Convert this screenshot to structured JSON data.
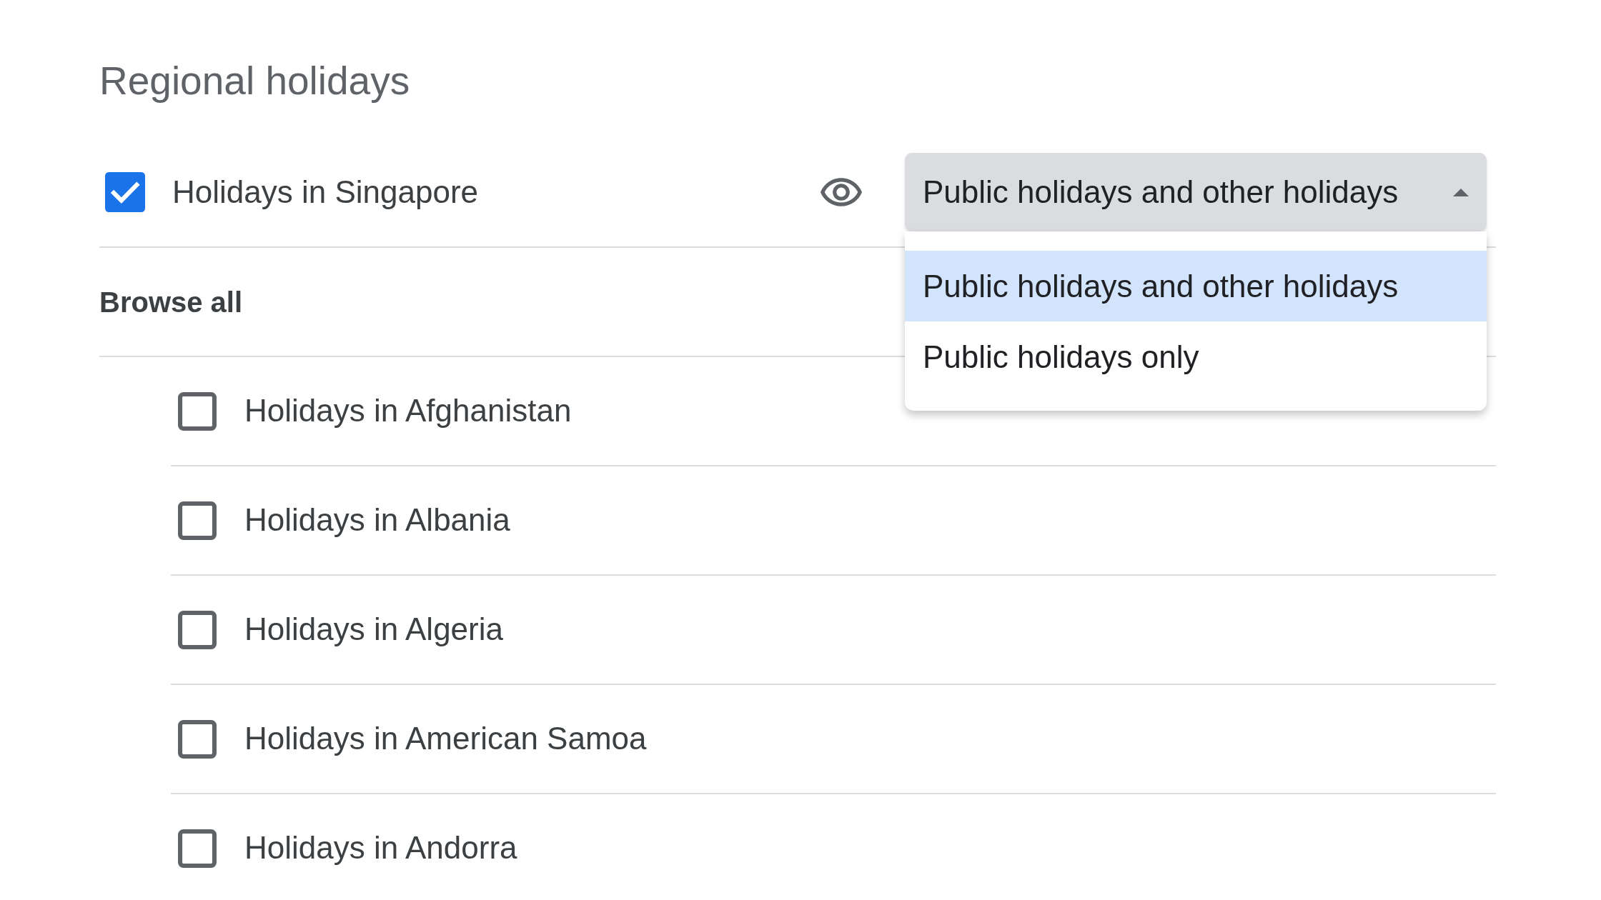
{
  "section_title": "Regional holidays",
  "regional_calendar": {
    "label": "Holidays in Singapore",
    "checked": true,
    "select": {
      "value": "Public holidays and other holidays",
      "expanded": true,
      "options": [
        {
          "label": "Public holidays and other holidays",
          "selected": true
        },
        {
          "label": "Public holidays only",
          "selected": false
        }
      ]
    }
  },
  "browse_all": {
    "label": "Browse all"
  },
  "countries": [
    {
      "label": "Holidays in Afghanistan",
      "checked": false
    },
    {
      "label": "Holidays in Albania",
      "checked": false
    },
    {
      "label": "Holidays in Algeria",
      "checked": false
    },
    {
      "label": "Holidays in American Samoa",
      "checked": false
    },
    {
      "label": "Holidays in Andorra",
      "checked": false
    }
  ]
}
